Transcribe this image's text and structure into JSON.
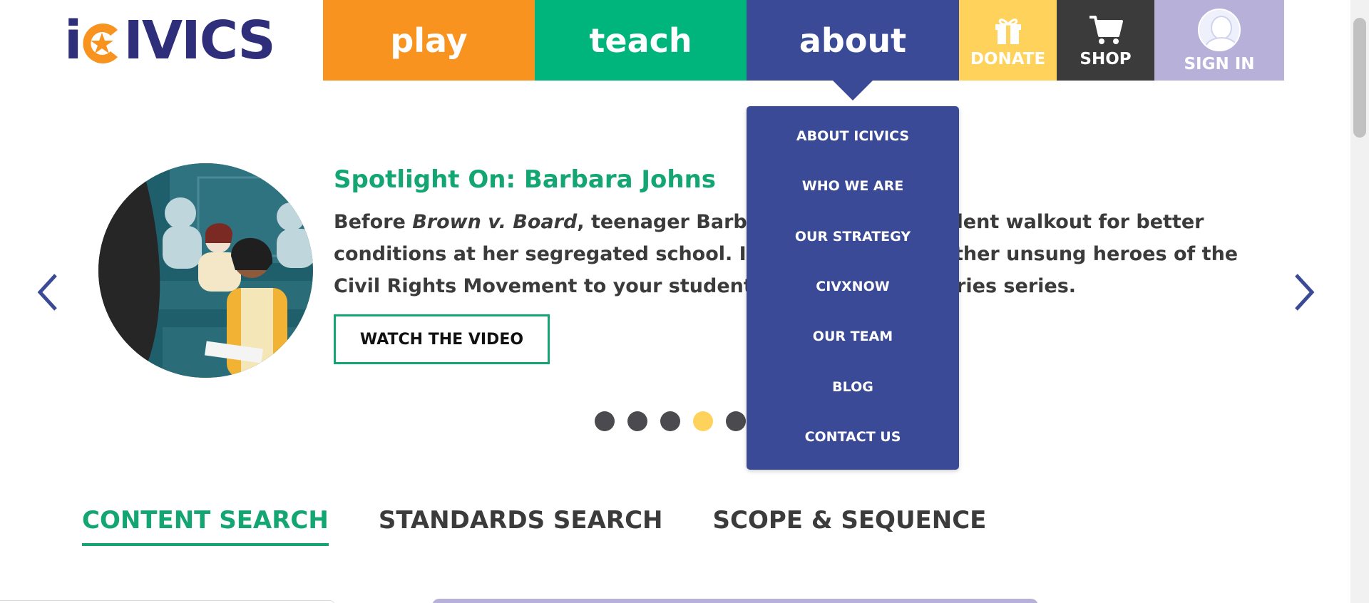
{
  "logo": {
    "text_before": "i",
    "text_after": "IVICS"
  },
  "nav": {
    "play": "play",
    "teach": "teach",
    "about": "about",
    "donate": "DONATE",
    "shop": "SHOP",
    "signin": "SIGN IN"
  },
  "about_menu": {
    "items": [
      "ABOUT ICIVICS",
      "WHO WE ARE",
      "OUR STRATEGY",
      "CIVXNOW",
      "OUR TEAM",
      "BLOG",
      "CONTACT US"
    ]
  },
  "spotlight": {
    "title": "Spotlight On: Barbara Johns",
    "body_prefix": "Before ",
    "body_italic": "Brown v. Board",
    "body_rest": ", teenager Barbara Johns led a student walkout for better conditions at her segregated school. Introduce her and other unsung heroes of the Civil Rights Movement to your students in our Untold Stories series.",
    "button": "WATCH THE VIDEO"
  },
  "carousel": {
    "dot_count": 5,
    "active_index": 3
  },
  "search_tabs": {
    "items": [
      "CONTENT SEARCH",
      "STANDARDS SEARCH",
      "SCOPE & SEQUENCE"
    ],
    "active_index": 0
  },
  "colors": {
    "play": "#f7931e",
    "teach": "#00b57c",
    "about": "#3a4a97",
    "donate": "#ffd25c",
    "shop": "#3b3b3b",
    "signin": "#b7b1da",
    "accent_green": "#13a673"
  },
  "icons": {
    "donate": "gift-icon",
    "shop": "cart-icon",
    "signin": "avatar-icon",
    "prev": "chevron-left-icon",
    "next": "chevron-right-icon"
  }
}
